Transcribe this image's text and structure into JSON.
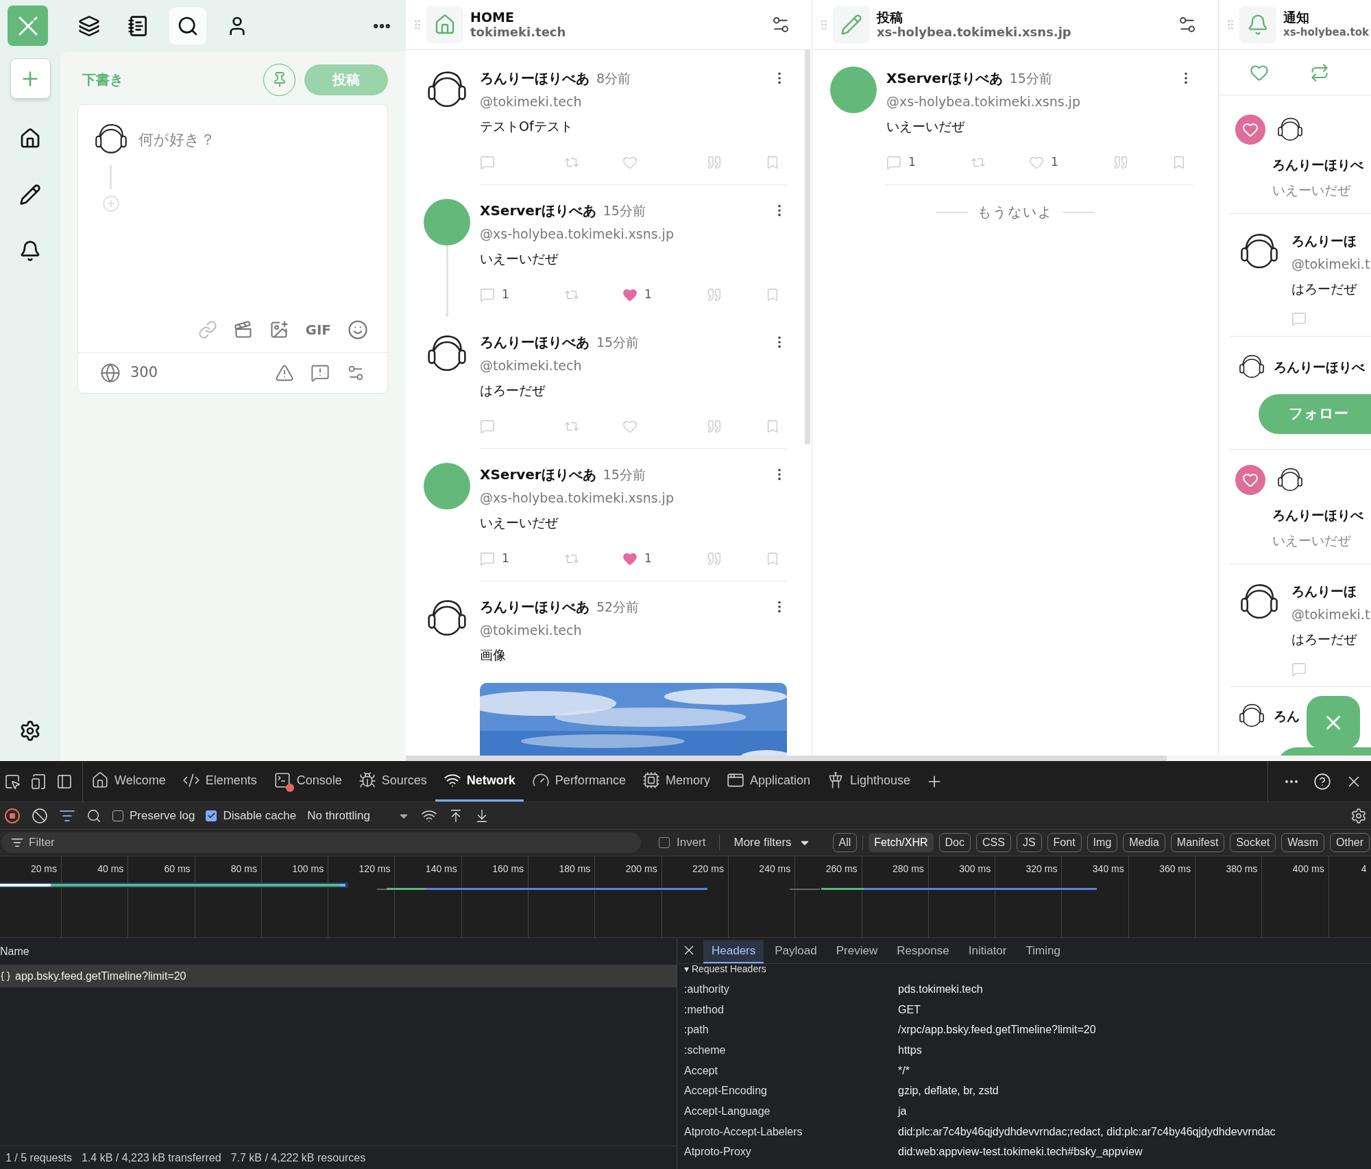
{
  "top_nav": [
    {
      "kind": "decks",
      "selected": false
    },
    {
      "kind": "lists",
      "selected": false
    },
    {
      "kind": "search",
      "selected": true
    },
    {
      "kind": "profile",
      "selected": false
    }
  ],
  "rail": [
    {
      "kind": "home"
    },
    {
      "kind": "compose"
    },
    {
      "kind": "notifications"
    }
  ],
  "compose": {
    "title": "下書き",
    "post_button": {
      "label": "投稿",
      "disabled": true
    },
    "placeholder": "何が好き？",
    "gif": "GIF",
    "char_count": "300"
  },
  "columns": [
    {
      "kind": "home",
      "title": "HOME",
      "subtitle": "tokimeki.tech",
      "posts": [
        {
          "avatar": {
            "kind": "sketch"
          },
          "name": "ろんりーほりべあ",
          "time": "8分前",
          "handle": "@tokimeki.tech",
          "text": "テストOfテスト",
          "liked": false,
          "thread": false
        },
        {
          "avatar": {
            "kind": "green"
          },
          "name": "XServerほりべあ",
          "time": "15分前",
          "handle": "@xs-holybea.tokimeki.xsns.jp",
          "text": "いえーいだぜ",
          "replies": "1",
          "likes": "1",
          "liked": true,
          "thread": true
        },
        {
          "avatar": {
            "kind": "sketch"
          },
          "name": "ろんりーほりべあ",
          "time": "15分前",
          "handle": "@tokimeki.tech",
          "text": "はろーだぜ",
          "liked": false,
          "thread": false
        },
        {
          "avatar": {
            "kind": "green"
          },
          "name": "XServerほりべあ",
          "time": "15分前",
          "handle": "@xs-holybea.tokimeki.xsns.jp",
          "text": "いえーいだぜ",
          "replies": "1",
          "likes": "1",
          "liked": true,
          "thread": false
        },
        {
          "avatar": {
            "kind": "sketch"
          },
          "name": "ろんりーほりべあ",
          "time": "52分前",
          "handle": "@tokimeki.tech",
          "text": "画像"
        }
      ]
    },
    {
      "kind": "compose",
      "title": "投稿",
      "subtitle": "xs-holybea.tokimeki.xsns.jp",
      "end_text": "もうないよ",
      "posts": [
        {
          "avatar": {
            "kind": "green"
          },
          "name": "XServerほりべあ",
          "time": "15分前",
          "handle": "@xs-holybea.tokimeki.xsns.jp",
          "text": "いえーいだぜ",
          "replies": "1",
          "likes": "1",
          "liked": false,
          "thread": false
        }
      ]
    }
  ],
  "notifications": {
    "title": "通知",
    "subtitle": "xs-holybea.tok",
    "tabs": [
      {
        "kind": "like"
      },
      {
        "kind": "repost"
      }
    ],
    "items": [
      {
        "kind": "like",
        "name": "ろんりーほりべ",
        "text": "いえーいだぜ"
      },
      {
        "kind": "post",
        "name": "ろんりーほ",
        "handle": "@tokimeki.t",
        "text": "はろーだぜ"
      },
      {
        "kind": "follow",
        "name": "ろんりーほりべ",
        "button": "フォロー"
      },
      {
        "kind": "like",
        "name": "ろんりーほりべ",
        "text": "いえーいだぜ"
      },
      {
        "kind": "post",
        "name": "ろんりーほ",
        "handle": "@tokimeki.t",
        "text": "はろーだぜ"
      },
      {
        "kind": "partial",
        "name": "ろん"
      }
    ]
  },
  "devtools": {
    "tabs": [
      {
        "kind": "welcome",
        "label": "Welcome",
        "selected": false
      },
      {
        "kind": "elements",
        "label": "Elements",
        "selected": false
      },
      {
        "kind": "console",
        "label": "Console",
        "selected": false,
        "has_errors": true
      },
      {
        "kind": "sources",
        "label": "Sources",
        "selected": false
      },
      {
        "kind": "network",
        "label": "Network",
        "selected": true
      },
      {
        "kind": "performance",
        "label": "Performance",
        "selected": false
      },
      {
        "kind": "memory",
        "label": "Memory",
        "selected": false
      },
      {
        "kind": "application",
        "label": "Application",
        "selected": false
      },
      {
        "kind": "lighthouse",
        "label": "Lighthouse",
        "selected": false
      }
    ],
    "recording": true,
    "preserve_log": {
      "label": "Preserve log",
      "checked": false
    },
    "disable_cache": {
      "label": "Disable cache",
      "checked": true
    },
    "throttling": "No throttling",
    "filter": {
      "placeholder": "Filter",
      "invert": {
        "label": "Invert",
        "checked": false
      },
      "more_filters": "More filters",
      "types": [
        {
          "label": "All",
          "selected": false
        },
        {
          "label": "Fetch/XHR",
          "selected": true
        },
        {
          "label": "Doc",
          "selected": false
        },
        {
          "label": "CSS",
          "selected": false
        },
        {
          "label": "JS",
          "selected": false
        },
        {
          "label": "Font",
          "selected": false
        },
        {
          "label": "Img",
          "selected": false
        },
        {
          "label": "Media",
          "selected": false
        },
        {
          "label": "Manifest",
          "selected": false
        },
        {
          "label": "Socket",
          "selected": false
        },
        {
          "label": "Wasm",
          "selected": false
        },
        {
          "label": "Other",
          "selected": false
        }
      ]
    },
    "timeline": {
      "ticks": [
        "20 ms",
        "40 ms",
        "60 ms",
        "80 ms",
        "100 ms",
        "120 ms",
        "140 ms",
        "160 ms",
        "180 ms",
        "200 ms",
        "220 ms",
        "240 ms",
        "260 ms",
        "280 ms",
        "300 ms",
        "320 ms",
        "340 ms",
        "360 ms",
        "380 ms",
        "400 ms",
        "4"
      ]
    },
    "requests": {
      "column": "Name",
      "rows": [
        {
          "name": "app.bsky.feed.getTimeline?limit=20",
          "selected": true
        }
      ]
    },
    "details": {
      "tabs": [
        {
          "label": "Headers",
          "selected": true
        },
        {
          "label": "Payload",
          "selected": false
        },
        {
          "label": "Preview",
          "selected": false
        },
        {
          "label": "Response",
          "selected": false
        },
        {
          "label": "Initiator",
          "selected": false
        },
        {
          "label": "Timing",
          "selected": false
        }
      ],
      "section": "▾ Request Headers",
      "headers": [
        {
          "name": ":authority",
          "value": "pds.tokimeki.tech"
        },
        {
          "name": ":method",
          "value": "GET"
        },
        {
          "name": ":path",
          "value": "/xrpc/app.bsky.feed.getTimeline?limit=20"
        },
        {
          "name": ":scheme",
          "value": "https"
        },
        {
          "name": "Accept",
          "value": "*/*"
        },
        {
          "name": "Accept-Encoding",
          "value": "gzip, deflate, br, zstd"
        },
        {
          "name": "Accept-Language",
          "value": "ja"
        },
        {
          "name": "Atproto-Accept-Labelers",
          "value": "did:plc:ar7c4by46qjdydhdevvrndac;redact, did:plc:ar7c4by46qjdydhdevvrndac"
        },
        {
          "name": "Atproto-Proxy",
          "value": "did:web:appview-test.tokimeki.tech#bsky_appview"
        }
      ]
    },
    "status": [
      "1 / 5 requests",
      "1.4 kB / 4,223 kB transferred",
      "7.7 kB / 4,222 kB resources"
    ]
  }
}
